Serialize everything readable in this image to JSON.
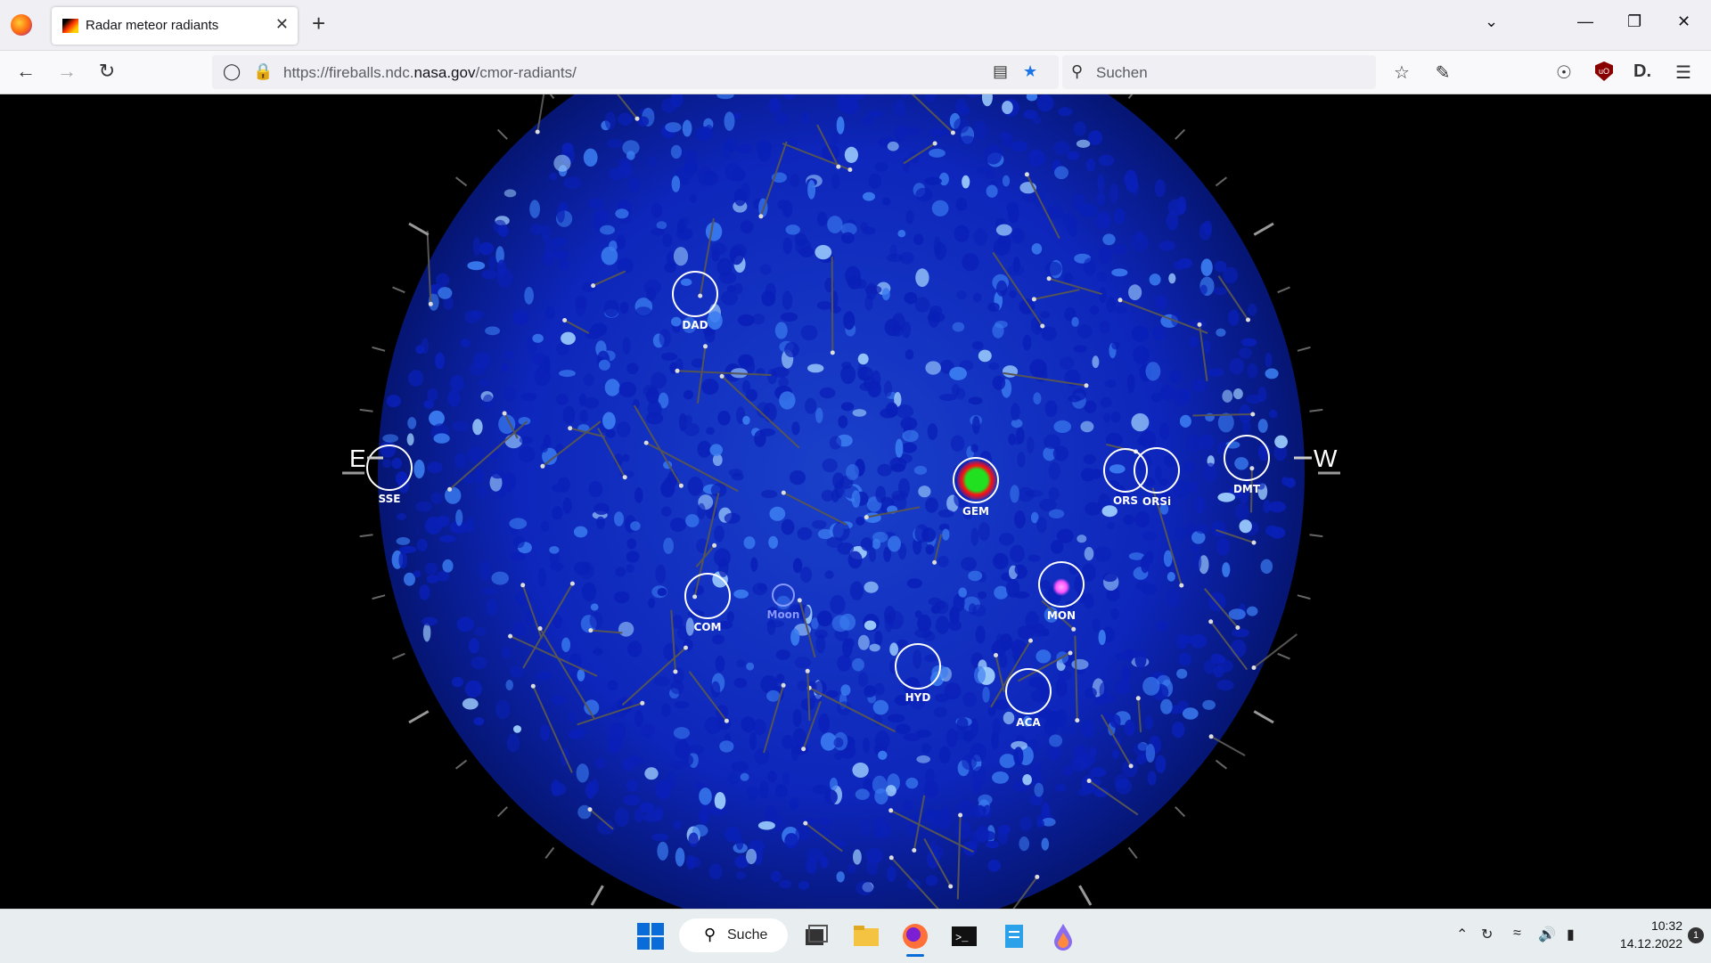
{
  "browser": {
    "tab_title": "Radar meteor radiants",
    "tab_close": "✕",
    "new_tab": "+",
    "url_prefix": "https://fireballs.ndc.",
    "url_host": "nasa.gov",
    "url_path": "/cmor-radiants/",
    "search_placeholder": "Suchen"
  },
  "sky_map": {
    "compass_east": "E",
    "compass_west": "W",
    "radiants": [
      {
        "code": "DAD",
        "color": "#ffffff"
      },
      {
        "code": "SSE",
        "color": "#ffffff"
      },
      {
        "code": "GEM",
        "color": "#ffffff"
      },
      {
        "code": "ORS",
        "color": "#ffffff"
      },
      {
        "code": "ORSi",
        "color": "#ffffff"
      },
      {
        "code": "DMT",
        "color": "#ffffff"
      },
      {
        "code": "COM",
        "color": "#ffffff"
      },
      {
        "code": "Moon",
        "color": "#8899ff"
      },
      {
        "code": "MON",
        "color": "#ffffff"
      },
      {
        "code": "HYD",
        "color": "#ffffff"
      },
      {
        "code": "ACA",
        "color": "#ffffff"
      }
    ]
  },
  "taskbar": {
    "search_label": "Suche",
    "time": "10:32",
    "date": "14.12.2022",
    "notification_count": "1"
  },
  "colors": {
    "sky_blue": "#0a2ad8",
    "hotspot_green": "#20e020",
    "hotspot_red": "#ff1010",
    "hotspot_magenta": "#ff55ff"
  }
}
